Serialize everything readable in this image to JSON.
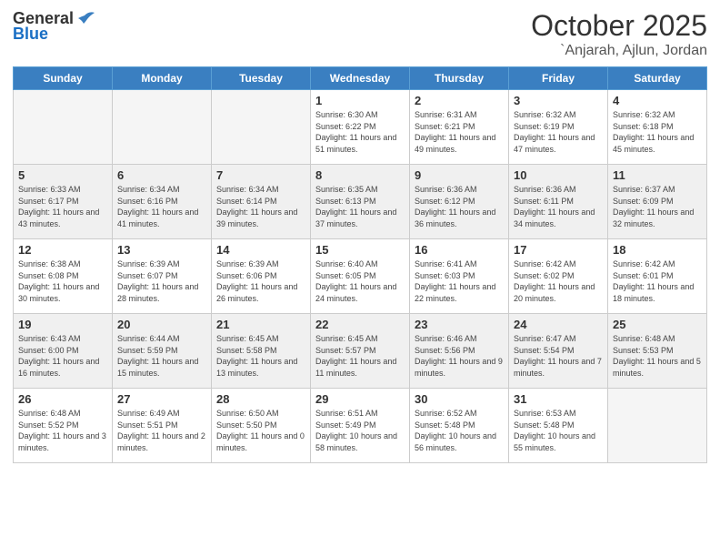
{
  "logo": {
    "general": "General",
    "blue": "Blue"
  },
  "title": {
    "month": "October 2025",
    "location": "`Anjarah, Ajlun, Jordan"
  },
  "weekdays": [
    "Sunday",
    "Monday",
    "Tuesday",
    "Wednesday",
    "Thursday",
    "Friday",
    "Saturday"
  ],
  "weeks": [
    [
      {
        "day": "",
        "empty": true
      },
      {
        "day": "",
        "empty": true
      },
      {
        "day": "",
        "empty": true
      },
      {
        "day": "1",
        "sunrise": "6:30 AM",
        "sunset": "6:22 PM",
        "daylight": "11 hours and 51 minutes."
      },
      {
        "day": "2",
        "sunrise": "6:31 AM",
        "sunset": "6:21 PM",
        "daylight": "11 hours and 49 minutes."
      },
      {
        "day": "3",
        "sunrise": "6:32 AM",
        "sunset": "6:19 PM",
        "daylight": "11 hours and 47 minutes."
      },
      {
        "day": "4",
        "sunrise": "6:32 AM",
        "sunset": "6:18 PM",
        "daylight": "11 hours and 45 minutes."
      }
    ],
    [
      {
        "day": "5",
        "sunrise": "6:33 AM",
        "sunset": "6:17 PM",
        "daylight": "11 hours and 43 minutes."
      },
      {
        "day": "6",
        "sunrise": "6:34 AM",
        "sunset": "6:16 PM",
        "daylight": "11 hours and 41 minutes."
      },
      {
        "day": "7",
        "sunrise": "6:34 AM",
        "sunset": "6:14 PM",
        "daylight": "11 hours and 39 minutes."
      },
      {
        "day": "8",
        "sunrise": "6:35 AM",
        "sunset": "6:13 PM",
        "daylight": "11 hours and 37 minutes."
      },
      {
        "day": "9",
        "sunrise": "6:36 AM",
        "sunset": "6:12 PM",
        "daylight": "11 hours and 36 minutes."
      },
      {
        "day": "10",
        "sunrise": "6:36 AM",
        "sunset": "6:11 PM",
        "daylight": "11 hours and 34 minutes."
      },
      {
        "day": "11",
        "sunrise": "6:37 AM",
        "sunset": "6:09 PM",
        "daylight": "11 hours and 32 minutes."
      }
    ],
    [
      {
        "day": "12",
        "sunrise": "6:38 AM",
        "sunset": "6:08 PM",
        "daylight": "11 hours and 30 minutes."
      },
      {
        "day": "13",
        "sunrise": "6:39 AM",
        "sunset": "6:07 PM",
        "daylight": "11 hours and 28 minutes."
      },
      {
        "day": "14",
        "sunrise": "6:39 AM",
        "sunset": "6:06 PM",
        "daylight": "11 hours and 26 minutes."
      },
      {
        "day": "15",
        "sunrise": "6:40 AM",
        "sunset": "6:05 PM",
        "daylight": "11 hours and 24 minutes."
      },
      {
        "day": "16",
        "sunrise": "6:41 AM",
        "sunset": "6:03 PM",
        "daylight": "11 hours and 22 minutes."
      },
      {
        "day": "17",
        "sunrise": "6:42 AM",
        "sunset": "6:02 PM",
        "daylight": "11 hours and 20 minutes."
      },
      {
        "day": "18",
        "sunrise": "6:42 AM",
        "sunset": "6:01 PM",
        "daylight": "11 hours and 18 minutes."
      }
    ],
    [
      {
        "day": "19",
        "sunrise": "6:43 AM",
        "sunset": "6:00 PM",
        "daylight": "11 hours and 16 minutes."
      },
      {
        "day": "20",
        "sunrise": "6:44 AM",
        "sunset": "5:59 PM",
        "daylight": "11 hours and 15 minutes."
      },
      {
        "day": "21",
        "sunrise": "6:45 AM",
        "sunset": "5:58 PM",
        "daylight": "11 hours and 13 minutes."
      },
      {
        "day": "22",
        "sunrise": "6:45 AM",
        "sunset": "5:57 PM",
        "daylight": "11 hours and 11 minutes."
      },
      {
        "day": "23",
        "sunrise": "6:46 AM",
        "sunset": "5:56 PM",
        "daylight": "11 hours and 9 minutes."
      },
      {
        "day": "24",
        "sunrise": "6:47 AM",
        "sunset": "5:54 PM",
        "daylight": "11 hours and 7 minutes."
      },
      {
        "day": "25",
        "sunrise": "6:48 AM",
        "sunset": "5:53 PM",
        "daylight": "11 hours and 5 minutes."
      }
    ],
    [
      {
        "day": "26",
        "sunrise": "6:48 AM",
        "sunset": "5:52 PM",
        "daylight": "11 hours and 3 minutes."
      },
      {
        "day": "27",
        "sunrise": "6:49 AM",
        "sunset": "5:51 PM",
        "daylight": "11 hours and 2 minutes."
      },
      {
        "day": "28",
        "sunrise": "6:50 AM",
        "sunset": "5:50 PM",
        "daylight": "11 hours and 0 minutes."
      },
      {
        "day": "29",
        "sunrise": "6:51 AM",
        "sunset": "5:49 PM",
        "daylight": "10 hours and 58 minutes."
      },
      {
        "day": "30",
        "sunrise": "6:52 AM",
        "sunset": "5:48 PM",
        "daylight": "10 hours and 56 minutes."
      },
      {
        "day": "31",
        "sunrise": "6:53 AM",
        "sunset": "5:48 PM",
        "daylight": "10 hours and 55 minutes."
      },
      {
        "day": "",
        "empty": true
      }
    ]
  ]
}
